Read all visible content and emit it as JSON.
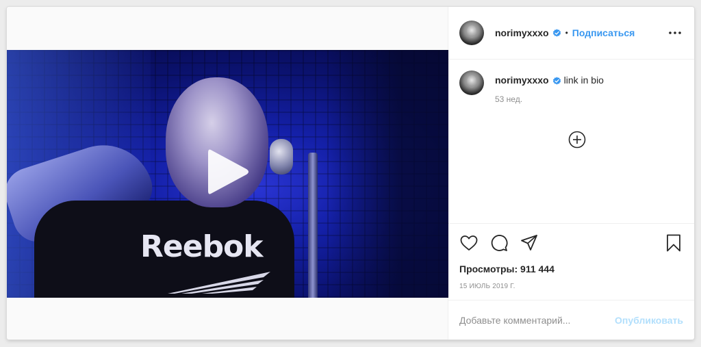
{
  "post": {
    "username": "norimyxxxo",
    "follow_label": "Подписаться",
    "separator": "•",
    "caption_text": "link in bio",
    "caption_time": "53 нед.",
    "views_label": "Просмотры: 911 444",
    "date": "15 июль 2019 г.",
    "video_logo_text": "Reebok"
  },
  "comment": {
    "placeholder": "Добавьте комментарий...",
    "publish_label": "Опубликовать"
  },
  "colors": {
    "accent": "#3897f0",
    "publish_disabled": "#b2dffc",
    "text": "#262626",
    "muted": "#8e8e8e"
  },
  "icons": {
    "verified": "verified-badge-icon",
    "more": "more-horizontal-icon",
    "play": "play-icon",
    "load_more": "plus-circle-icon",
    "like": "heart-icon",
    "comment": "comment-bubble-icon",
    "share": "paper-plane-icon",
    "save": "bookmark-icon"
  }
}
